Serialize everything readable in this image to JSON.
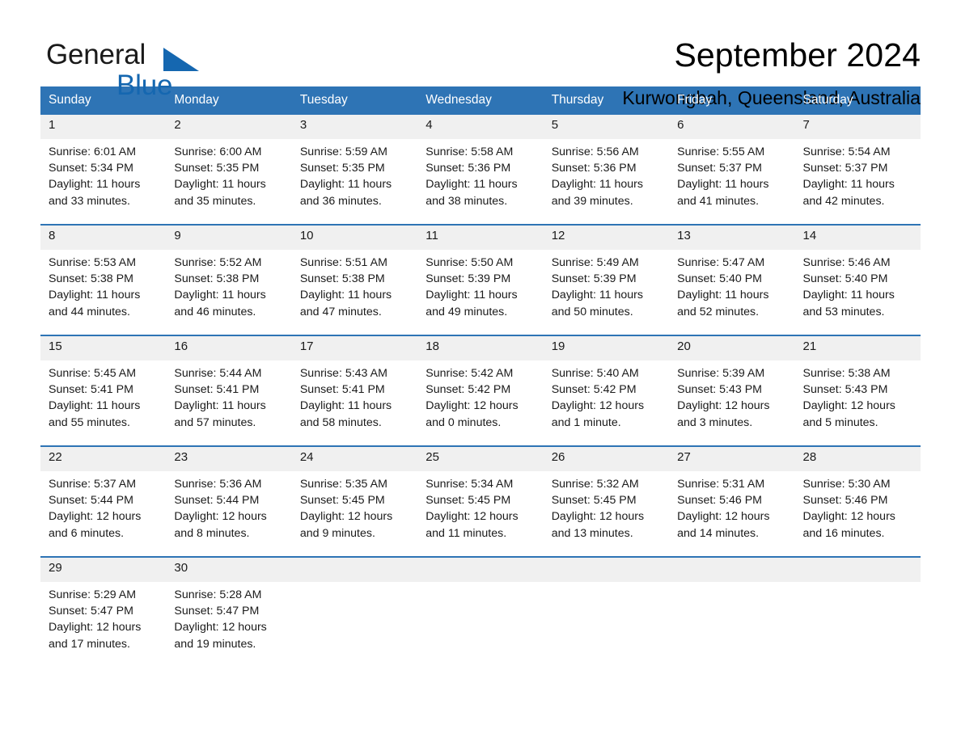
{
  "brand": {
    "word_one": "General",
    "word_two": "Blue",
    "triangle_icon": "brand-triangle-icon",
    "accent_color": "#1567b0"
  },
  "header": {
    "title": "September 2024",
    "subtitle": "Kurwongbah, Queensland, Australia"
  },
  "theme": {
    "header_bg": "#2e74b5",
    "daynum_bg": "#f0f0f0",
    "rule_color": "#2e74b5",
    "text_color": "#1a1a1a"
  },
  "calendar": {
    "weekday_headers": [
      "Sunday",
      "Monday",
      "Tuesday",
      "Wednesday",
      "Thursday",
      "Friday",
      "Saturday"
    ],
    "weeks": [
      [
        {
          "day": "1",
          "sunrise": "Sunrise: 6:01 AM",
          "sunset": "Sunset: 5:34 PM",
          "daylight": "Daylight: 11 hours and 33 minutes."
        },
        {
          "day": "2",
          "sunrise": "Sunrise: 6:00 AM",
          "sunset": "Sunset: 5:35 PM",
          "daylight": "Daylight: 11 hours and 35 minutes."
        },
        {
          "day": "3",
          "sunrise": "Sunrise: 5:59 AM",
          "sunset": "Sunset: 5:35 PM",
          "daylight": "Daylight: 11 hours and 36 minutes."
        },
        {
          "day": "4",
          "sunrise": "Sunrise: 5:58 AM",
          "sunset": "Sunset: 5:36 PM",
          "daylight": "Daylight: 11 hours and 38 minutes."
        },
        {
          "day": "5",
          "sunrise": "Sunrise: 5:56 AM",
          "sunset": "Sunset: 5:36 PM",
          "daylight": "Daylight: 11 hours and 39 minutes."
        },
        {
          "day": "6",
          "sunrise": "Sunrise: 5:55 AM",
          "sunset": "Sunset: 5:37 PM",
          "daylight": "Daylight: 11 hours and 41 minutes."
        },
        {
          "day": "7",
          "sunrise": "Sunrise: 5:54 AM",
          "sunset": "Sunset: 5:37 PM",
          "daylight": "Daylight: 11 hours and 42 minutes."
        }
      ],
      [
        {
          "day": "8",
          "sunrise": "Sunrise: 5:53 AM",
          "sunset": "Sunset: 5:38 PM",
          "daylight": "Daylight: 11 hours and 44 minutes."
        },
        {
          "day": "9",
          "sunrise": "Sunrise: 5:52 AM",
          "sunset": "Sunset: 5:38 PM",
          "daylight": "Daylight: 11 hours and 46 minutes."
        },
        {
          "day": "10",
          "sunrise": "Sunrise: 5:51 AM",
          "sunset": "Sunset: 5:38 PM",
          "daylight": "Daylight: 11 hours and 47 minutes."
        },
        {
          "day": "11",
          "sunrise": "Sunrise: 5:50 AM",
          "sunset": "Sunset: 5:39 PM",
          "daylight": "Daylight: 11 hours and 49 minutes."
        },
        {
          "day": "12",
          "sunrise": "Sunrise: 5:49 AM",
          "sunset": "Sunset: 5:39 PM",
          "daylight": "Daylight: 11 hours and 50 minutes."
        },
        {
          "day": "13",
          "sunrise": "Sunrise: 5:47 AM",
          "sunset": "Sunset: 5:40 PM",
          "daylight": "Daylight: 11 hours and 52 minutes."
        },
        {
          "day": "14",
          "sunrise": "Sunrise: 5:46 AM",
          "sunset": "Sunset: 5:40 PM",
          "daylight": "Daylight: 11 hours and 53 minutes."
        }
      ],
      [
        {
          "day": "15",
          "sunrise": "Sunrise: 5:45 AM",
          "sunset": "Sunset: 5:41 PM",
          "daylight": "Daylight: 11 hours and 55 minutes."
        },
        {
          "day": "16",
          "sunrise": "Sunrise: 5:44 AM",
          "sunset": "Sunset: 5:41 PM",
          "daylight": "Daylight: 11 hours and 57 minutes."
        },
        {
          "day": "17",
          "sunrise": "Sunrise: 5:43 AM",
          "sunset": "Sunset: 5:41 PM",
          "daylight": "Daylight: 11 hours and 58 minutes."
        },
        {
          "day": "18",
          "sunrise": "Sunrise: 5:42 AM",
          "sunset": "Sunset: 5:42 PM",
          "daylight": "Daylight: 12 hours and 0 minutes."
        },
        {
          "day": "19",
          "sunrise": "Sunrise: 5:40 AM",
          "sunset": "Sunset: 5:42 PM",
          "daylight": "Daylight: 12 hours and 1 minute."
        },
        {
          "day": "20",
          "sunrise": "Sunrise: 5:39 AM",
          "sunset": "Sunset: 5:43 PM",
          "daylight": "Daylight: 12 hours and 3 minutes."
        },
        {
          "day": "21",
          "sunrise": "Sunrise: 5:38 AM",
          "sunset": "Sunset: 5:43 PM",
          "daylight": "Daylight: 12 hours and 5 minutes."
        }
      ],
      [
        {
          "day": "22",
          "sunrise": "Sunrise: 5:37 AM",
          "sunset": "Sunset: 5:44 PM",
          "daylight": "Daylight: 12 hours and 6 minutes."
        },
        {
          "day": "23",
          "sunrise": "Sunrise: 5:36 AM",
          "sunset": "Sunset: 5:44 PM",
          "daylight": "Daylight: 12 hours and 8 minutes."
        },
        {
          "day": "24",
          "sunrise": "Sunrise: 5:35 AM",
          "sunset": "Sunset: 5:45 PM",
          "daylight": "Daylight: 12 hours and 9 minutes."
        },
        {
          "day": "25",
          "sunrise": "Sunrise: 5:34 AM",
          "sunset": "Sunset: 5:45 PM",
          "daylight": "Daylight: 12 hours and 11 minutes."
        },
        {
          "day": "26",
          "sunrise": "Sunrise: 5:32 AM",
          "sunset": "Sunset: 5:45 PM",
          "daylight": "Daylight: 12 hours and 13 minutes."
        },
        {
          "day": "27",
          "sunrise": "Sunrise: 5:31 AM",
          "sunset": "Sunset: 5:46 PM",
          "daylight": "Daylight: 12 hours and 14 minutes."
        },
        {
          "day": "28",
          "sunrise": "Sunrise: 5:30 AM",
          "sunset": "Sunset: 5:46 PM",
          "daylight": "Daylight: 12 hours and 16 minutes."
        }
      ],
      [
        {
          "day": "29",
          "sunrise": "Sunrise: 5:29 AM",
          "sunset": "Sunset: 5:47 PM",
          "daylight": "Daylight: 12 hours and 17 minutes."
        },
        {
          "day": "30",
          "sunrise": "Sunrise: 5:28 AM",
          "sunset": "Sunset: 5:47 PM",
          "daylight": "Daylight: 12 hours and 19 minutes."
        },
        {
          "day": "",
          "sunrise": "",
          "sunset": "",
          "daylight": ""
        },
        {
          "day": "",
          "sunrise": "",
          "sunset": "",
          "daylight": ""
        },
        {
          "day": "",
          "sunrise": "",
          "sunset": "",
          "daylight": ""
        },
        {
          "day": "",
          "sunrise": "",
          "sunset": "",
          "daylight": ""
        },
        {
          "day": "",
          "sunrise": "",
          "sunset": "",
          "daylight": ""
        }
      ]
    ]
  }
}
